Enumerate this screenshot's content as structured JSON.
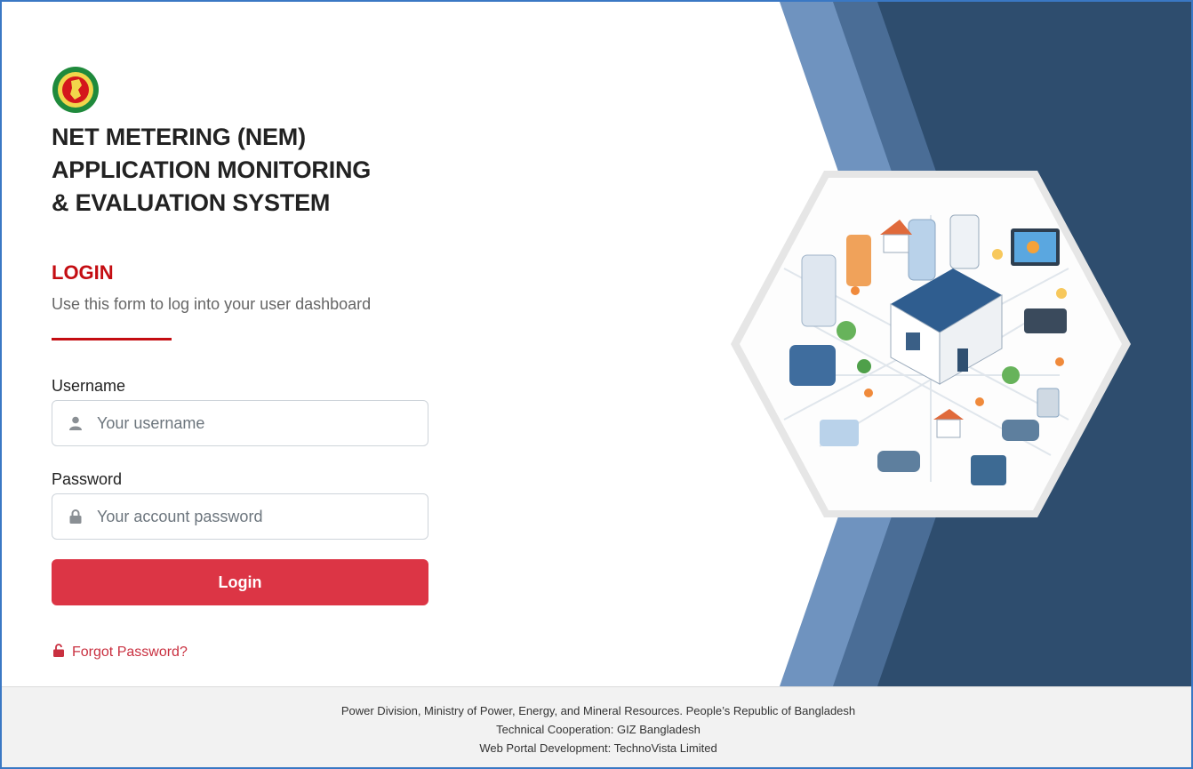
{
  "app": {
    "title_lines": [
      "NET METERING (NEM)",
      "APPLICATION MONITORING",
      "& EVALUATION SYSTEM"
    ]
  },
  "login": {
    "heading": "LOGIN",
    "subtitle": "Use this form to log into your user dashboard",
    "username_label": "Username",
    "username_placeholder": "Your username",
    "username_value": "",
    "password_label": "Password",
    "password_placeholder": "Your account password",
    "password_value": "",
    "submit_label": "Login",
    "forgot_label": "Forgot Password?"
  },
  "footer": {
    "line1": "Power Division, Ministry of Power, Energy, and Mineral Resources. People’s Republic of Bangladesh",
    "line2": "Technical Cooperation: GIZ Bangladesh",
    "line3": "Web Portal Development: TechnoVista Limited"
  },
  "icons": {
    "logo": "government-seal-logo",
    "username": "user-icon",
    "password": "lock-icon",
    "forgot": "unlock-icon",
    "illustration": "smart-home-solar-illustration"
  },
  "colors": {
    "accent_red": "#c40d12",
    "button_red": "#dc3545",
    "link_red": "#c93040",
    "panel_dark_blue": "#2e4d6e",
    "panel_mid_blue": "#4a6d96",
    "panel_light_blue": "#6f93bf"
  }
}
